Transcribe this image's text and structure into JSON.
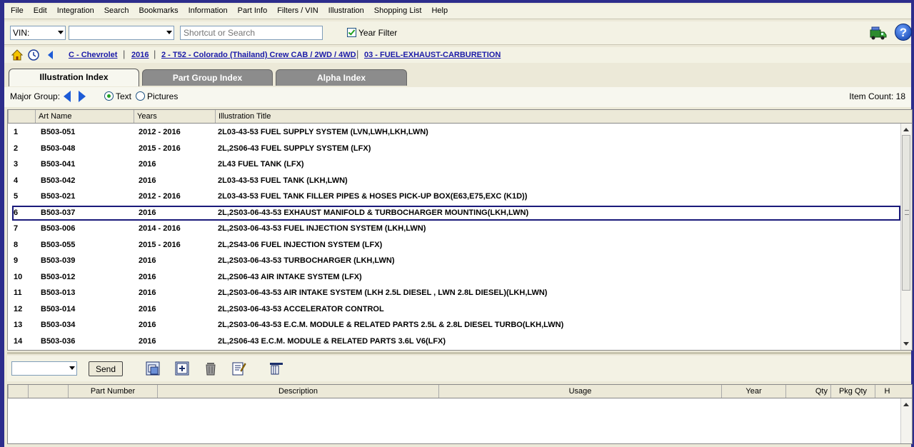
{
  "menu": [
    "File",
    "Edit",
    "Integration",
    "Search",
    "Bookmarks",
    "Information",
    "Part Info",
    "Filters / VIN",
    "Illustration",
    "Shopping List",
    "Help"
  ],
  "toolbar": {
    "vin_label": "VIN:",
    "vin_value": "",
    "search_placeholder": "Shortcut or Search",
    "year_filter_label": "Year Filter",
    "year_filter_checked": true
  },
  "breadcrumb": {
    "items": [
      "C - Chevrolet",
      "2016",
      "2 - T52 - Colorado (Thailand) Crew CAB  / 2WD  / 4WD",
      "03 - FUEL-EXHAUST-CARBURETION"
    ],
    "separator": "|"
  },
  "tabs": [
    {
      "label": "Illustration Index",
      "active": true
    },
    {
      "label": "Part Group Index",
      "active": false
    },
    {
      "label": "Alpha Index",
      "active": false
    }
  ],
  "major_group": {
    "label": "Major Group:",
    "radio_text": "Text",
    "radio_pictures": "Pictures",
    "item_count": "Item Count: 18"
  },
  "grid": {
    "columns": [
      "",
      "Art Name",
      "Years",
      "Illustration Title"
    ],
    "selected_index": 5,
    "rows": [
      [
        "1",
        "B503-051",
        "2012 - 2016",
        "2L03-43-53 FUEL SUPPLY SYSTEM (LVN,LWH,LKH,LWN)"
      ],
      [
        "2",
        "B503-048",
        "2015 - 2016",
        "2L,2S06-43 FUEL SUPPLY SYSTEM (LFX)"
      ],
      [
        "3",
        "B503-041",
        "2016",
        "2L43 FUEL TANK (LFX)"
      ],
      [
        "4",
        "B503-042",
        "2016",
        "2L03-43-53 FUEL TANK (LKH,LWN)"
      ],
      [
        "5",
        "B503-021",
        "2012 - 2016",
        "2L03-43-53 FUEL TANK FILLER PIPES & HOSES PICK-UP BOX(E63,E75,EXC (K1D))"
      ],
      [
        "6",
        "B503-037",
        "2016",
        "2L,2S03-06-43-53 EXHAUST MANIFOLD & TURBOCHARGER MOUNTING(LKH,LWN)"
      ],
      [
        "7",
        "B503-006",
        "2014 - 2016",
        "2L,2S03-06-43-53 FUEL INJECTION SYSTEM (LKH,LWN)"
      ],
      [
        "8",
        "B503-055",
        "2015 - 2016",
        "2L,2S43-06 FUEL INJECTION SYSTEM (LFX)"
      ],
      [
        "9",
        "B503-039",
        "2016",
        "2L,2S03-06-43-53 TURBOCHARGER (LKH,LWN)"
      ],
      [
        "10",
        "B503-012",
        "2016",
        "2L,2S06-43 AIR INTAKE SYSTEM (LFX)"
      ],
      [
        "11",
        "B503-013",
        "2016",
        "2L,2S03-06-43-53 AIR INTAKE SYSTEM (LKH 2.5L DIESEL , LWN 2.8L DIESEL)(LKH,LWN)"
      ],
      [
        "12",
        "B503-014",
        "2016",
        "2L,2S03-06-43-53 ACCELERATOR CONTROL"
      ],
      [
        "13",
        "B503-034",
        "2016",
        "2L,2S03-06-43-53 E.C.M. MODULE & RELATED PARTS 2.5L & 2.8L DIESEL TURBO(LKH,LWN)"
      ],
      [
        "14",
        "B503-036",
        "2016",
        "2L,2S06-43 E.C.M. MODULE & RELATED PARTS 3.6L V6(LFX)"
      ]
    ]
  },
  "bottom_toolbar": {
    "send_label": "Send",
    "icons": [
      "copy-icon",
      "add-icon",
      "delete-icon",
      "notes-icon",
      "columns-icon"
    ]
  },
  "lower_grid": {
    "columns": [
      "",
      "",
      "Part Number",
      "Description",
      "Usage",
      "Year",
      "Qty",
      "Pkg Qty",
      "H"
    ]
  },
  "colors": {
    "accent_blue": "#1a1aa8",
    "frame": "#2d2d8c",
    "tab_inactive": "#8c8c8c",
    "panel": "#ECE9D8"
  }
}
